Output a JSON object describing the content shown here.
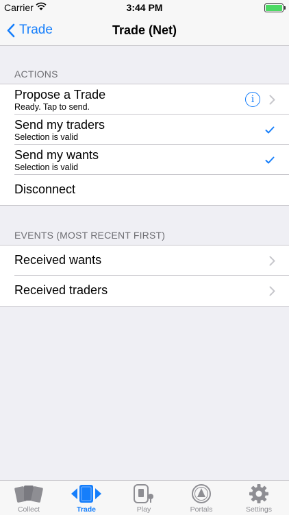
{
  "status": {
    "carrier": "Carrier",
    "time": "3:44 PM"
  },
  "nav": {
    "back_label": "Trade",
    "title": "Trade (Net)"
  },
  "actions": {
    "header": "ACTIONS",
    "rows": [
      {
        "title": "Propose a Trade",
        "subtitle": "Ready.  Tap to send."
      },
      {
        "title": "Send my traders",
        "subtitle": "Selection is valid"
      },
      {
        "title": "Send my wants",
        "subtitle": "Selection is valid"
      },
      {
        "title": "Disconnect"
      }
    ]
  },
  "events": {
    "header": "EVENTS (MOST RECENT FIRST)",
    "rows": [
      {
        "title": "Received wants"
      },
      {
        "title": "Received traders"
      }
    ]
  },
  "tabs": [
    {
      "label": "Collect",
      "icon": "cards-icon"
    },
    {
      "label": "Trade",
      "icon": "trade-icon"
    },
    {
      "label": "Play",
      "icon": "play-icon"
    },
    {
      "label": "Portals",
      "icon": "portal-icon"
    },
    {
      "label": "Settings",
      "icon": "gear-icon"
    }
  ],
  "colors": {
    "accent": "#157efb",
    "background": "#efeff4",
    "separator": "#c8c7cc"
  }
}
